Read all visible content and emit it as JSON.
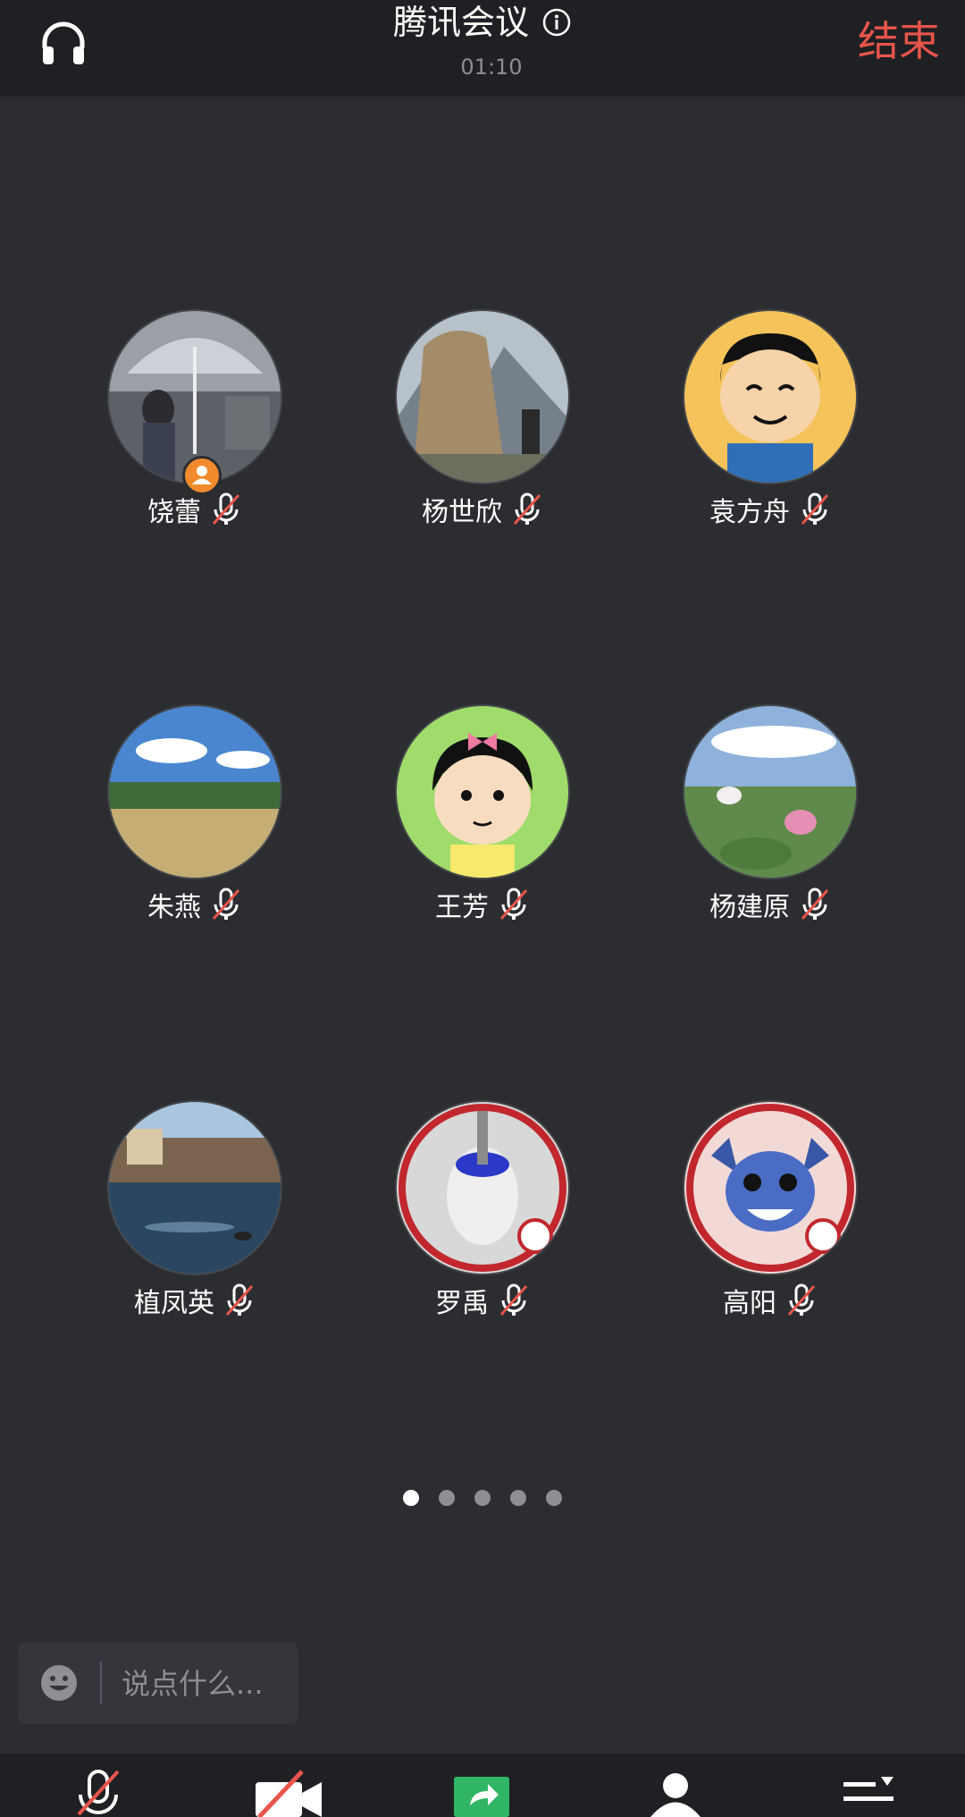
{
  "header": {
    "title": "腾讯会议",
    "elapsed": "01:10",
    "end_label": "结束",
    "end_color": "#e8554a",
    "left_icon": "headphone-icon",
    "info_icon": "info-icon"
  },
  "participants": [
    {
      "name": "饶蕾",
      "muted": true,
      "host": true
    },
    {
      "name": "杨世欣",
      "muted": true
    },
    {
      "name": "袁方舟",
      "muted": true
    },
    {
      "name": "朱燕",
      "muted": true
    },
    {
      "name": "王芳",
      "muted": true
    },
    {
      "name": "杨建原",
      "muted": true
    },
    {
      "name": "植凤英",
      "muted": true
    },
    {
      "name": "罗禹",
      "muted": true
    },
    {
      "name": "高阳",
      "muted": true
    }
  ],
  "pagination": {
    "pages": 5,
    "current": 1
  },
  "chat": {
    "placeholder": "说点什么...",
    "icon": "emoji-icon"
  },
  "toolbar": {
    "icons": [
      "mic-muted-icon",
      "camera-off-icon",
      "share-screen-icon",
      "participants-icon",
      "more-menu-icon"
    ]
  }
}
